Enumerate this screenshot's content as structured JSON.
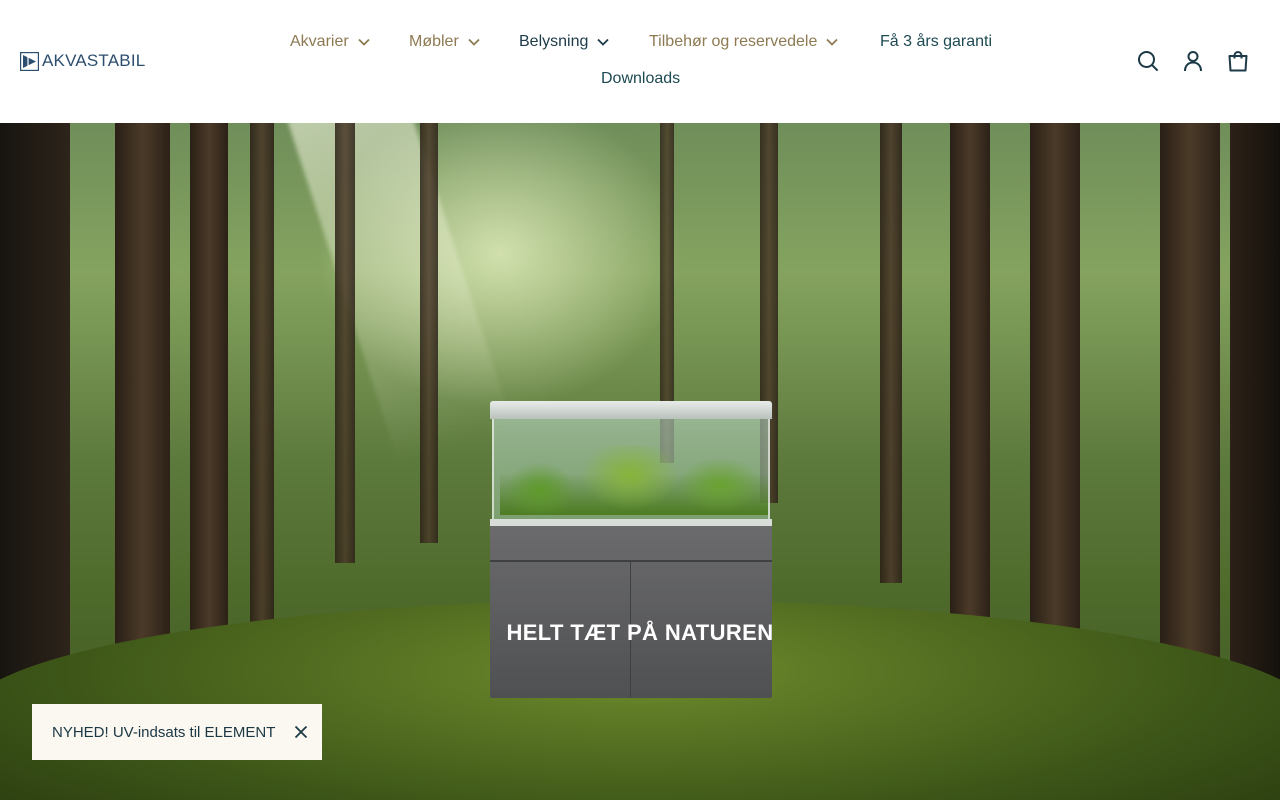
{
  "brand": {
    "name": "AKVASTABIL"
  },
  "nav": {
    "items": [
      {
        "label": "Akvarier",
        "has_dropdown": true
      },
      {
        "label": "Møbler",
        "has_dropdown": true
      },
      {
        "label": "Belysning",
        "has_dropdown": true
      },
      {
        "label": "Tilbehør og reservedele",
        "has_dropdown": true
      },
      {
        "label": "Få 3 års garanti",
        "has_dropdown": false
      },
      {
        "label": "Downloads",
        "has_dropdown": false
      }
    ]
  },
  "header_icons": [
    "search-icon",
    "account-icon",
    "cart-icon"
  ],
  "hero": {
    "title": "HELT TÆT PÅ NATUREN"
  },
  "announcement": {
    "text": "NYHED! UV-indsats til ELEMENT"
  },
  "colors": {
    "brand": "#2d4e6e",
    "nav_muted": "#8d7a52",
    "nav_dark": "#1d3a48",
    "toast_bg": "#fbf7f1"
  }
}
